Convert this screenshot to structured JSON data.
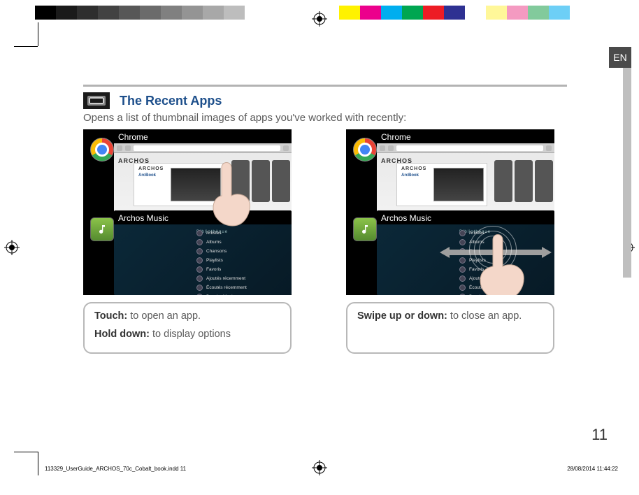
{
  "lang_tab": "EN",
  "heading": "The Recent Apps",
  "subtext": "Opens a list of thumbnail images of apps you've worked with recently:",
  "card_top_label": "Chrome",
  "card_bot_label": "Archos Music",
  "site_brand": "ARCHOS",
  "hero_brand": "ARCHOS",
  "hero_product": "ArcBook",
  "music_section": "Bibliothèque",
  "music_items": [
    "Artistes",
    "Albums",
    "Chansons",
    "Playlists",
    "Favoris",
    "Ajoutés récemment",
    "Écoutés récemment",
    "Dossier Musique"
  ],
  "left_caption": {
    "line1_bold": "Touch:",
    "line1_rest": " to open an app.",
    "line2_bold": "Hold down:",
    "line2_rest": " to display options"
  },
  "right_caption": {
    "line1_bold": "Swipe up or down:",
    "line1_rest": " to close an app."
  },
  "page_number": "11",
  "imprint_file": "113329_UserGuide_ARCHOS_70c_Cobalt_book.indd   11",
  "imprint_date": "28/08/2014   11:44:22",
  "colorbars_left": [
    "#000000",
    "#1a1a1a",
    "#2e2e2e",
    "#424242",
    "#575757",
    "#6b6b6b",
    "#808080",
    "#949494",
    "#a8a8a8",
    "#bdbdbd",
    "#ffffff"
  ],
  "colorbars_right": [
    "#fff200",
    "#ec008c",
    "#00aeef",
    "#00a651",
    "#ed1c24",
    "#2e3192",
    "#ffffff",
    "#fff799",
    "#f49ac1",
    "#82ca9c",
    "#6dcff6"
  ]
}
